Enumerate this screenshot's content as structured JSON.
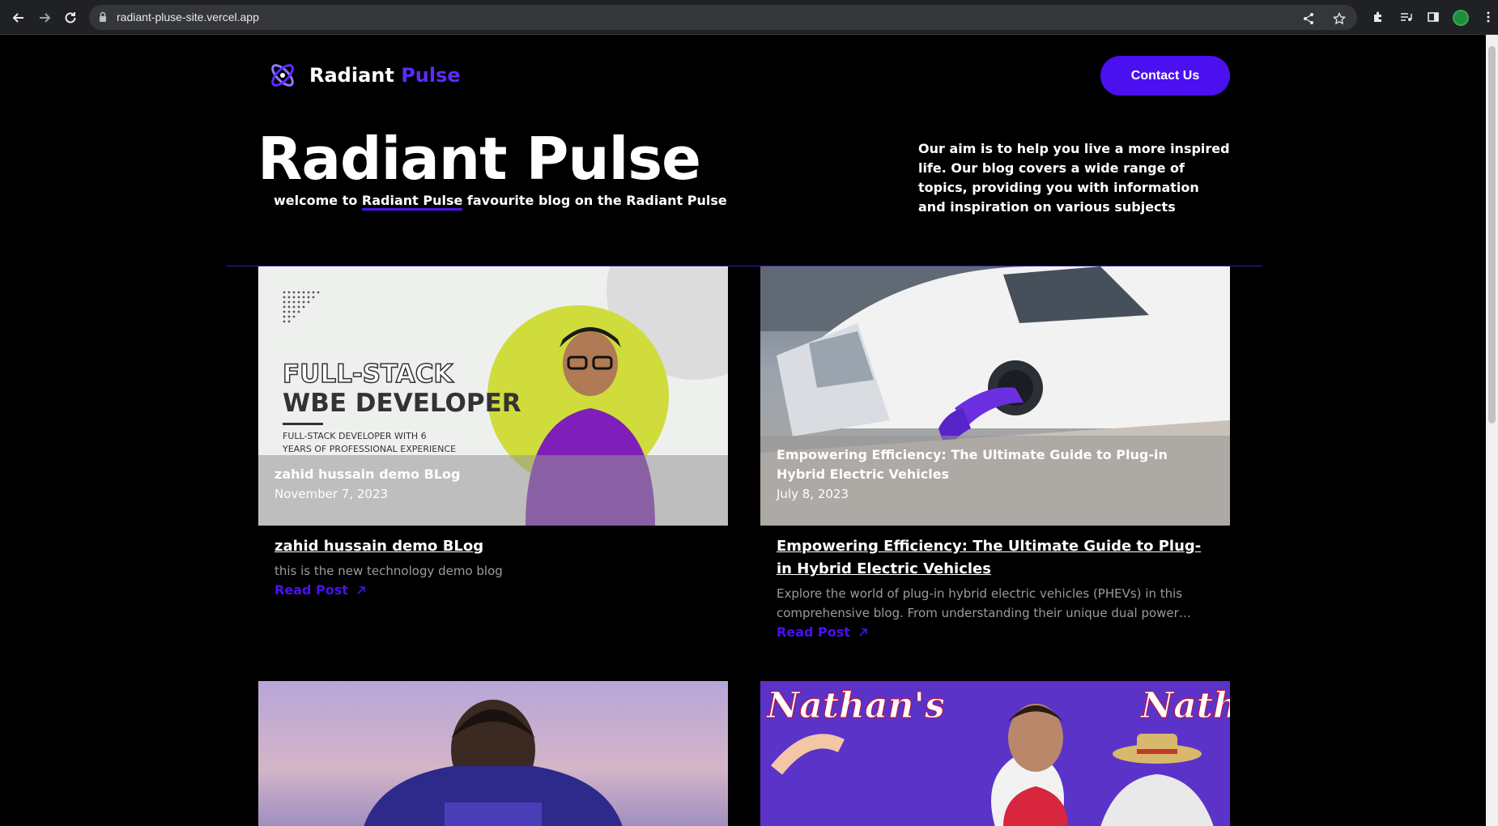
{
  "browser": {
    "url": "radiant-pluse-site.vercel.app",
    "icons": [
      "back-icon",
      "forward-icon",
      "reload-icon",
      "lock-icon",
      "share-icon",
      "star-icon",
      "extensions-icon",
      "media-icon",
      "sidepanel-icon",
      "profile-avatar",
      "menu-icon"
    ]
  },
  "header": {
    "logo_word1": "Radiant",
    "logo_word2": "Pulse",
    "contact_label": "Contact Us"
  },
  "hero": {
    "title": "Radiant Pulse",
    "tagline_pre": "welcome to",
    "tagline_link": "Radiant Pulse",
    "tagline_post": "favourite blog on the Radiant Pulse",
    "aim": "Our aim is to help you live a more inspired life. Our blog covers a wide range of topics, providing you with information and inspiration on various subjects"
  },
  "posts": [
    {
      "overlay_title": "zahid hussain demo BLog",
      "date": "November 7, 2023",
      "title": "zahid hussain demo BLog",
      "description": "this is the new technology demo blog",
      "read_label": "Read Post",
      "image_text": {
        "line1": "FULL-STACK",
        "line2": "WBE DEVELOPER",
        "line3": "FULL-STACK DEVELOPER WITH 6",
        "line4": "YEARS OF PROFESSIONAL EXPERIENCE"
      }
    },
    {
      "overlay_title": "Empowering Efficiency: The Ultimate Guide to Plug-in Hybrid Electric Vehicles",
      "date": "July 8, 2023",
      "title": "Empowering Efficiency: The Ultimate Guide to Plug-in Hybrid Electric Vehicles",
      "description": "Explore the world of plug-in hybrid electric vehicles (PHEVs) in this comprehensive blog. From understanding their unique dual power sources…",
      "read_label": "Read Post"
    },
    {
      "overlay_title": "",
      "date": ""
    },
    {
      "image_text": {
        "logo": "Nathan's"
      }
    }
  ],
  "colors": {
    "accent": "#4b10f0",
    "logo_accent": "#5b2bff",
    "background": "#000000",
    "muted_text": "#9b9b9b"
  }
}
